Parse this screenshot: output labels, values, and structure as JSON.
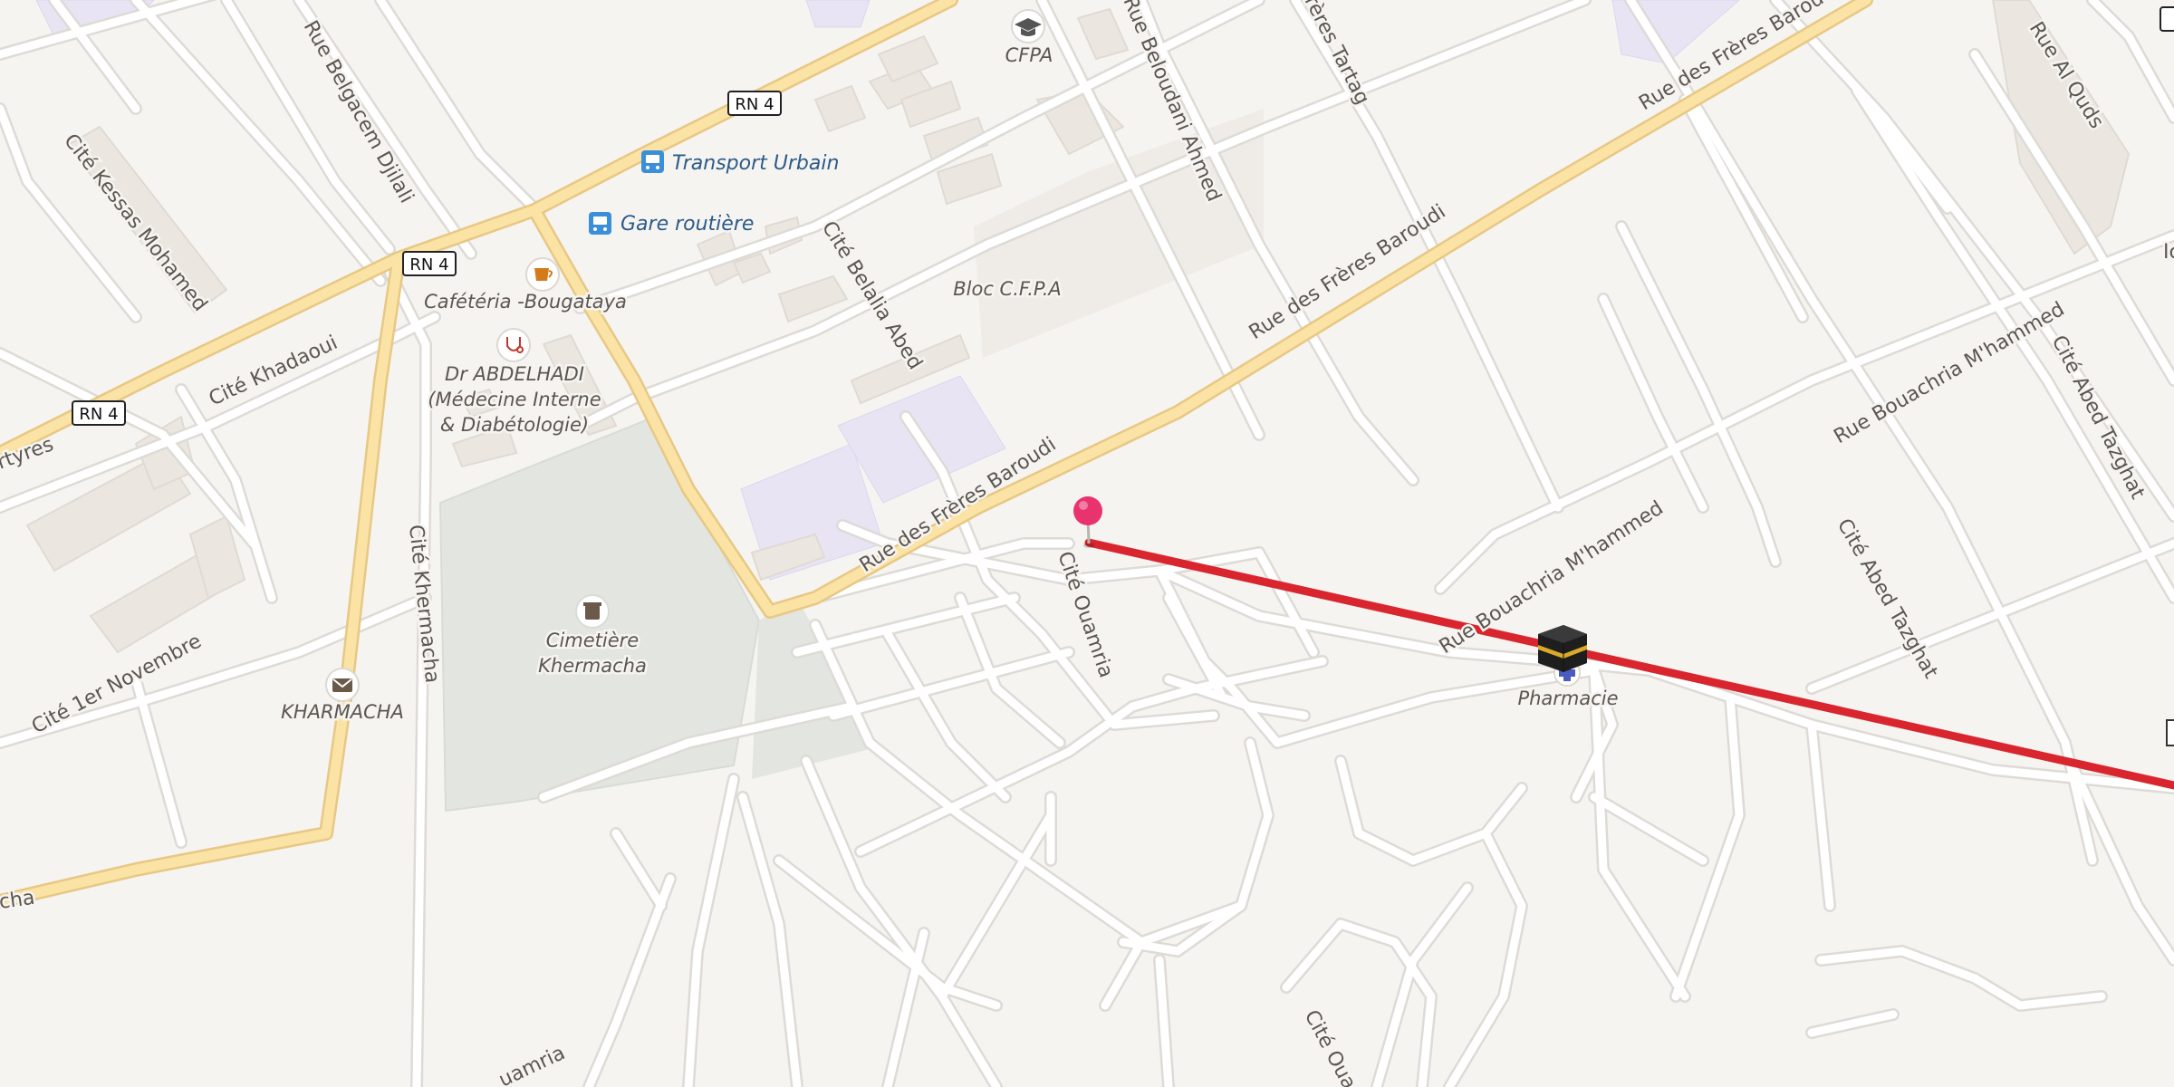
{
  "map": {
    "streets": {
      "rue_belgacem_djilali": "Rue Belgacem Djilali",
      "cite_kessas_mohamed": "Cité Kessas Mohamed",
      "cite_khadaoui": "Cité Khadaoui",
      "martyres_fragment": "rtyres",
      "cite_1er_novembre": "Cité 1er Novembre",
      "cite_khermacha": "Cité Khermacha",
      "cite_belalia_abed": "Cité Belalia Abed",
      "rue_beloudani_ahmed": "Rue Beloudani Ahmed",
      "freres_tartag_fragment": "rères Tartag",
      "rue_freres_baroudi": "Rue des Frères Baroudi",
      "rue_al_quds": "Rue Al Quds",
      "rue_bouachria": "Rue Bouachria M'hammed",
      "cite_abed_tazghat": "Cité Abed Tazghat",
      "cite_ouamria": "Cité Ouamria",
      "cite_oua_fragment": "Cité Oua",
      "ouamria_fragment": "uamria",
      "cha_fragment": "cha",
      "edge_fragment": "Ic"
    },
    "shields": {
      "rn4": "RN 4"
    },
    "pois": {
      "cfpa": {
        "label": "CFPA",
        "icon": "graduation-cap-icon"
      },
      "transport_urbain": {
        "label": "Transport Urbain",
        "icon": "bus-icon"
      },
      "gare_routiere": {
        "label": "Gare routière",
        "icon": "bus-icon"
      },
      "cafeteria": {
        "label": "Cafétéria -Bougataya",
        "icon": "coffee-cup-icon"
      },
      "doctor": {
        "line1": "Dr ABDELHADI",
        "line2": "(Médecine Interne",
        "line3": "& Diabétologie)",
        "icon": "stethoscope-icon"
      },
      "cemetery": {
        "line1": "Cimetière",
        "line2": "Khermacha",
        "icon": "cemetery-icon"
      },
      "post_office": {
        "label": "KHARMACHA",
        "icon": "mail-envelope-icon"
      },
      "bloc_cfpa": {
        "label": "Bloc C.F.P.A"
      },
      "pharmacie": {
        "label": "Pharmacie",
        "icon": "pharmacy-cross-icon"
      }
    },
    "markers": {
      "start_pin": "map-pin-icon",
      "destination": "kaaba-icon"
    },
    "colors": {
      "background": "#f6f4f1",
      "route_line": "#d9262e",
      "pin": "#e8336f",
      "main_road": "#fbe3a6",
      "transit_icon": "#3b8fd9",
      "cafe_icon": "#d47a1a",
      "doctor_icon": "#c0392b",
      "cemetery_area": "#e2e5e0"
    }
  }
}
